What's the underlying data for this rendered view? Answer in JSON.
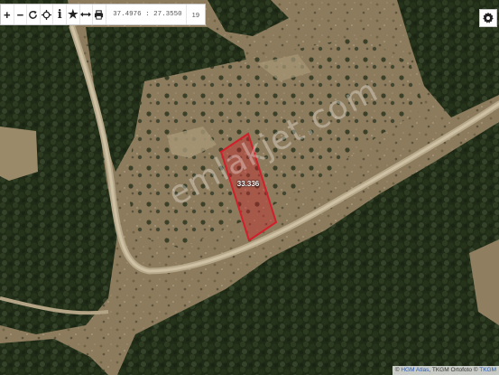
{
  "toolbar": {
    "tools": [
      {
        "name": "zoom-in-button",
        "glyph": "+"
      },
      {
        "name": "zoom-out-button",
        "glyph": "−"
      },
      {
        "name": "refresh-button",
        "icon": "refresh-icon"
      },
      {
        "name": "locate-button",
        "icon": "crosshair-icon"
      },
      {
        "name": "info-button",
        "glyph": "i"
      },
      {
        "name": "favorite-button",
        "glyph": "★"
      },
      {
        "name": "measure-button",
        "icon": "measure-icon"
      },
      {
        "name": "print-button",
        "icon": "printer-icon"
      }
    ],
    "coordinates": "37.4976 : 27.3550",
    "zoom": "19"
  },
  "settings": {
    "icon": "gear-icon"
  },
  "parcel": {
    "label": "33.336",
    "color": "#d31f2b"
  },
  "watermark": "emlakjet.com",
  "attribution": {
    "prefix": "© ",
    "hgm": "HGM Atlas",
    "middle": ", TKGM Ortofoto © ",
    "tkgm": "TKGM"
  }
}
